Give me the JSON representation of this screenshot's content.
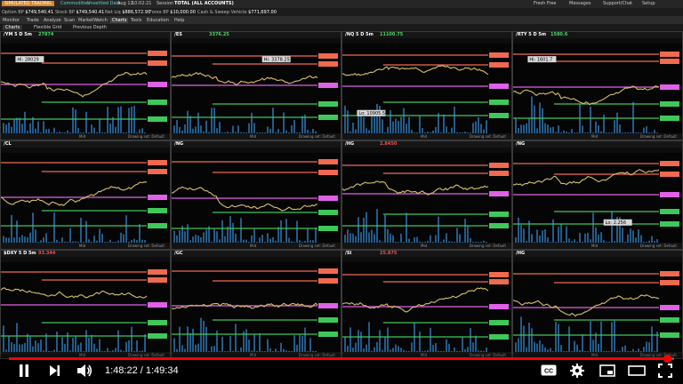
{
  "topbar": {
    "sim_label": "SIMULATED TRADING",
    "items": [
      "Commodities",
      "Unsettled Data",
      "Aug 12",
      "10:02:21",
      "Session",
      "TOTAL (ALL ACCOUNTS)"
    ],
    "right": [
      "Fresh Free",
      "Messages",
      "Support/Chat",
      "Setup"
    ]
  },
  "account": {
    "fields": [
      {
        "label": "Option BP",
        "value": "$749,540.41"
      },
      {
        "label": "Stock BP",
        "value": "$749,540.41"
      },
      {
        "label": "Net Liq",
        "value": "$886,572.90"
      },
      {
        "label": "Forex BP",
        "value": "$10,000.00"
      },
      {
        "label": "Cash & Sweep Vehicle",
        "value": "$771,697.00"
      }
    ]
  },
  "nav": {
    "items": [
      "Monitor",
      "Trade",
      "Analyze",
      "Scan",
      "MarketWatch",
      "Charts",
      "Tools",
      "Education",
      "Help"
    ],
    "active": "Charts"
  },
  "subtabs": [
    "Charts",
    "Flexible Grid",
    "Previous Depth"
  ],
  "panels": [
    {
      "symbol": "/YM 5 D 5m",
      "price": "27874",
      "dir": "up",
      "tag": "Hi: 28029",
      "tag_pos": "left"
    },
    {
      "symbol": "/ES",
      "price": "3376.25",
      "dir": "up",
      "tag": "Hi: 3378.25",
      "tag_pos": "right"
    },
    {
      "symbol": "/NQ 5 D 5m",
      "price": "11100.75",
      "dir": "up",
      "tag": "Lo: 10905.5",
      "tag_pos": "left"
    },
    {
      "symbol": "/RTY 5 D 5m",
      "price": "1580.6",
      "dir": "up",
      "tag": "Hi: 1601.7",
      "tag_pos": "left"
    },
    {
      "symbol": "/CL",
      "price": "",
      "dir": "up",
      "tag": "",
      "tag_pos": "left"
    },
    {
      "symbol": "/NG",
      "price": "",
      "dir": "up",
      "tag": "",
      "tag_pos": "left"
    },
    {
      "symbol": "/HG",
      "price": "2.8450",
      "dir": "dn",
      "tag": "",
      "tag_pos": "left"
    },
    {
      "symbol": "/NG",
      "price": "",
      "dir": "dn",
      "tag": "Lo: 2.256",
      "tag_pos": "right"
    },
    {
      "symbol": "$DXY 5 D 5m",
      "price": "93.344",
      "dir": "dn",
      "tag": "",
      "tag_pos": "left"
    },
    {
      "symbol": "/GC",
      "price": "",
      "dir": "dn",
      "tag": "",
      "tag_pos": "left"
    },
    {
      "symbol": "/SI",
      "price": "25.875",
      "dir": "dn",
      "tag": "",
      "tag_pos": "left"
    },
    {
      "symbol": "/HG",
      "price": "",
      "dir": "dn",
      "tag": "",
      "tag_pos": "left"
    }
  ],
  "footer": {
    "drawing_label": "Drawing set: Default",
    "center": "Mid"
  },
  "player": {
    "current": "1:48:22",
    "total": "1:49:34",
    "progress": 0.989
  },
  "colors": {
    "price_line": "#d9c06a",
    "level_red": "#f06a50",
    "level_magenta": "#e060e8",
    "level_green": "#3fc85a",
    "volume": "#2f78b8",
    "progress": "#ff0000"
  },
  "icons": [
    "play-icon",
    "pause-icon",
    "next-icon",
    "volume-icon",
    "cc-icon",
    "settings-icon",
    "miniplayer-icon",
    "theater-icon",
    "fullscreen-icon"
  ]
}
